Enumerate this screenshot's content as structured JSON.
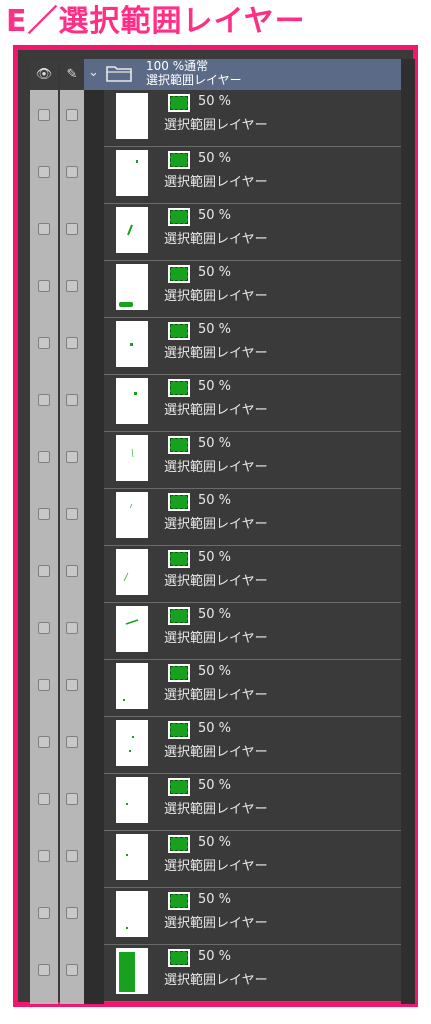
{
  "title": "E／選択範囲レイヤー",
  "header": {
    "eye_symbol": "👁",
    "pen_symbol": "✎",
    "chevron_symbol": "⌄",
    "folder_opacity_blend": "100 %通常",
    "folder_name": "選択範囲レイヤー"
  },
  "colors": {
    "title": "#ff2f86",
    "frame_border": "#f2166c",
    "panel_bg": "#3a3a3a",
    "folder_header_bg": "#5b6a86",
    "selection_green": "#18a01f"
  },
  "layers": [
    {
      "opacity": "50 %",
      "name": "選択範囲レイヤー",
      "icon": "selection-layer-icon"
    },
    {
      "opacity": "50 %",
      "name": "選択範囲レイヤー",
      "icon": "selection-layer-icon"
    },
    {
      "opacity": "50 %",
      "name": "選択範囲レイヤー",
      "icon": "selection-layer-icon"
    },
    {
      "opacity": "50 %",
      "name": "選択範囲レイヤー",
      "icon": "selection-layer-icon"
    },
    {
      "opacity": "50 %",
      "name": "選択範囲レイヤー",
      "icon": "selection-layer-icon"
    },
    {
      "opacity": "50 %",
      "name": "選択範囲レイヤー",
      "icon": "selection-layer-icon"
    },
    {
      "opacity": "50 %",
      "name": "選択範囲レイヤー",
      "icon": "selection-layer-icon"
    },
    {
      "opacity": "50 %",
      "name": "選択範囲レイヤー",
      "icon": "selection-layer-icon"
    },
    {
      "opacity": "50 %",
      "name": "選択範囲レイヤー",
      "icon": "selection-layer-icon"
    },
    {
      "opacity": "50 %",
      "name": "選択範囲レイヤー",
      "icon": "selection-layer-icon"
    },
    {
      "opacity": "50 %",
      "name": "選択範囲レイヤー",
      "icon": "selection-layer-icon"
    },
    {
      "opacity": "50 %",
      "name": "選択範囲レイヤー",
      "icon": "selection-layer-icon"
    },
    {
      "opacity": "50 %",
      "name": "選択範囲レイヤー",
      "icon": "selection-layer-icon"
    },
    {
      "opacity": "50 %",
      "name": "選択範囲レイヤー",
      "icon": "selection-layer-icon"
    },
    {
      "opacity": "50 %",
      "name": "選択範囲レイヤー",
      "icon": "selection-layer-icon"
    },
    {
      "opacity": "50 %",
      "name": "選択範囲レイヤー",
      "icon": "selection-layer-icon"
    }
  ]
}
